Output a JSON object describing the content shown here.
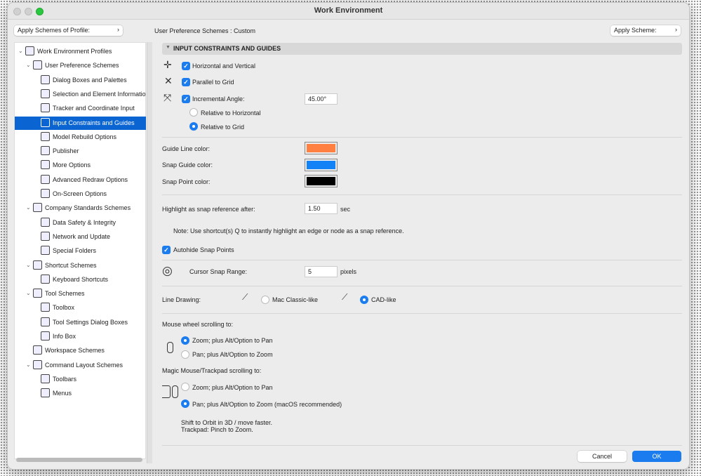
{
  "window": {
    "title": "Work Environment"
  },
  "toolbar": {
    "apply_profile": "Apply Schemes of Profile:",
    "scheme_label": "User Preference Schemes : ",
    "scheme_value": "Custom",
    "apply_scheme": "Apply Scheme:"
  },
  "tree": [
    {
      "label": "Work Environment Profiles",
      "level": 0,
      "expanded": true,
      "icon": "monitor-gear-icon"
    },
    {
      "label": "User Preference Schemes",
      "level": 1,
      "expanded": true,
      "icon": "user-floppy-icon"
    },
    {
      "label": "Dialog Boxes and Palettes",
      "level": 2,
      "icon": "windows-icon"
    },
    {
      "label": "Selection and Element Information",
      "level": 2,
      "icon": "selection-info-icon"
    },
    {
      "label": "Tracker and Coordinate Input",
      "level": 2,
      "icon": "xyz-icon"
    },
    {
      "label": "Input Constraints and Guides",
      "level": 2,
      "icon": "mouse-cursor-icon",
      "selected": true
    },
    {
      "label": "Model Rebuild Options",
      "level": 2,
      "icon": "bricks-icon"
    },
    {
      "label": "Publisher",
      "level": 2,
      "icon": "publisher-icon"
    },
    {
      "label": "More Options",
      "level": 2,
      "icon": "sliders-icon"
    },
    {
      "label": "Advanced Redraw Options",
      "level": 2,
      "icon": "redraw-icon"
    },
    {
      "label": "On-Screen Options",
      "level": 2,
      "icon": "screen-icon"
    },
    {
      "label": "Company Standards Schemes",
      "level": 1,
      "expanded": true,
      "icon": "company-floppy-icon"
    },
    {
      "label": "Data Safety & Integrity",
      "level": 2,
      "icon": "data-safety-icon"
    },
    {
      "label": "Network and Update",
      "level": 2,
      "icon": "globe-icon"
    },
    {
      "label": "Special Folders",
      "level": 2,
      "icon": "folder-icon"
    },
    {
      "label": "Shortcut Schemes",
      "level": 1,
      "expanded": true,
      "icon": "shortcut-floppy-icon"
    },
    {
      "label": "Keyboard Shortcuts",
      "level": 2,
      "icon": "keyboard-icon"
    },
    {
      "label": "Tool Schemes",
      "level": 1,
      "expanded": true,
      "icon": "tool-floppy-icon"
    },
    {
      "label": "Toolbox",
      "level": 2,
      "icon": "toolbox-icon"
    },
    {
      "label": "Tool Settings Dialog Boxes",
      "level": 2,
      "icon": "tool-settings-icon"
    },
    {
      "label": "Info Box",
      "level": 2,
      "icon": "info-box-icon"
    },
    {
      "label": "Workspace Schemes",
      "level": 1,
      "icon": "workspace-icon"
    },
    {
      "label": "Command Layout Schemes",
      "level": 1,
      "expanded": true,
      "icon": "command-floppy-icon"
    },
    {
      "label": "Toolbars",
      "level": 2,
      "icon": "toolbars-icon"
    },
    {
      "label": "Menus",
      "level": 2,
      "icon": "menus-icon"
    }
  ],
  "main": {
    "section_title": "INPUT CONSTRAINTS AND GUIDES",
    "horiz_vert": "Horizontal and Vertical",
    "horiz_vert_checked": true,
    "parallel_grid": "Parallel to Grid",
    "parallel_grid_checked": true,
    "incremental_angle": "Incremental Angle:",
    "incremental_angle_checked": true,
    "incremental_angle_value": "45.00°",
    "rel_horizontal": "Relative to Horizontal",
    "rel_grid": "Relative to Grid",
    "rel_selected": "grid",
    "guide_line_color_label": "Guide Line color:",
    "guide_line_color": "#ff8040",
    "snap_guide_color_label": "Snap Guide color:",
    "snap_guide_color": "#1482f7",
    "snap_point_color_label": "Snap Point color:",
    "snap_point_color": "#000000",
    "highlight_label": "Highlight as snap reference after:",
    "highlight_value": "1.50",
    "highlight_unit": "sec",
    "note": "Note: Use shortcut(s) Q to instantly highlight an edge or node as a snap reference.",
    "autohide": "Autohide Snap Points",
    "autohide_checked": true,
    "cursor_snap_label": "Cursor Snap Range:",
    "cursor_snap_value": "5",
    "cursor_snap_unit": "pixels",
    "line_drawing_label": "Line Drawing:",
    "mac_classic": "Mac Classic-like",
    "cad_like": "CAD-like",
    "line_drawing_selected": "cad",
    "mouse_wheel_label": "Mouse wheel scrolling to:",
    "mw_zoom": "Zoom; plus Alt/Option to Pan",
    "mw_pan": "Pan; plus Alt/Option to Zoom",
    "mw_selected": "zoom",
    "trackpad_label": "Magic Mouse/Trackpad scrolling to:",
    "tp_zoom": "Zoom; plus Alt/Option to Pan",
    "tp_pan": "Pan; plus Alt/Option to Zoom (macOS recommended)",
    "tp_selected": "pan",
    "hint1": "Shift to Orbit in 3D / move faster.",
    "hint2": "Trackpad: Pinch to Zoom."
  },
  "footer": {
    "cancel": "Cancel",
    "ok": "OK"
  },
  "colors": {
    "accent": "#1b7cf0",
    "selection": "#0a64d2"
  }
}
